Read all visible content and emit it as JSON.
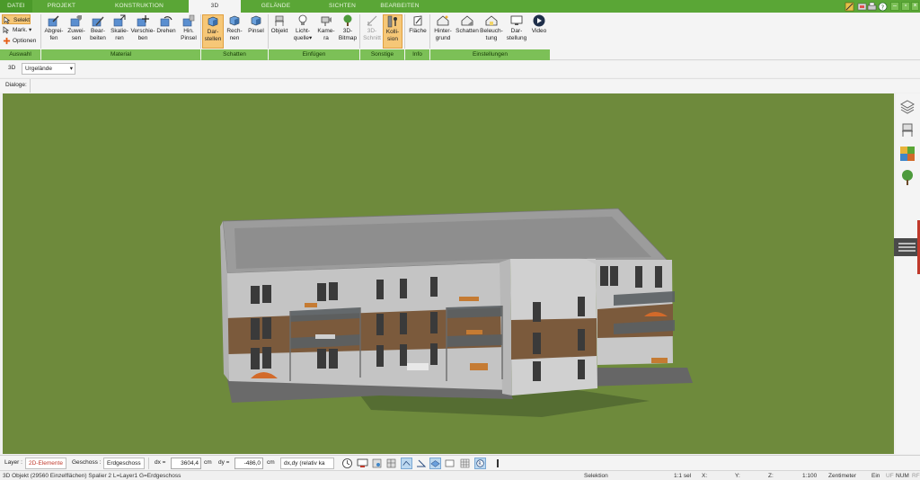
{
  "tabs": [
    {
      "label": "DATEI",
      "active": false
    },
    {
      "label": "PROJEKT",
      "active": false
    },
    {
      "label": "KONSTRUKTION",
      "active": false
    },
    {
      "label": "3D",
      "active": true
    },
    {
      "label": "GELÄNDE",
      "active": false
    },
    {
      "label": "SICHTEN",
      "active": false
    },
    {
      "label": "BEARBEITEN",
      "active": false
    }
  ],
  "ribbon": {
    "selection": [
      {
        "label": "Selekt",
        "icon": "cursor-icon",
        "active": true
      },
      {
        "label": "Mark.",
        "icon": "marker-icon",
        "has_dropdown": true
      },
      {
        "label": "Optionen",
        "icon": "plus-icon"
      }
    ],
    "material_buttons": [
      {
        "label": "Abgrei-\nfen",
        "icon": "eyedropper-icon"
      },
      {
        "label": "Zuwei-\nsen",
        "icon": "assign-material-icon"
      },
      {
        "label": "Bear-\nbeiten",
        "icon": "edit-material-icon"
      },
      {
        "label": "Skalie-\nren",
        "icon": "scale-icon"
      },
      {
        "label": "Verschie-\nben",
        "icon": "move-icon"
      },
      {
        "label": "Drehen",
        "icon": "rotate-icon"
      },
      {
        "label": "Hin.\nPinsel",
        "icon": "brush-icon"
      }
    ],
    "shadow_buttons": [
      {
        "label": "Dar-\nstellen",
        "icon": "cube-shade-icon",
        "active": true
      },
      {
        "label": "Rech-\nnen",
        "icon": "cube-calc-icon"
      },
      {
        "label": "Pinsel",
        "icon": "cube-brush-icon"
      }
    ],
    "insert_buttons": [
      {
        "label": "Objekt",
        "icon": "chair-icon"
      },
      {
        "label": "Licht-\nquelle",
        "icon": "lightbulb-icon",
        "has_dropdown": true
      },
      {
        "label": "Kame-\nra",
        "icon": "camera-icon"
      },
      {
        "label": "3D-\nBitmap",
        "icon": "tree-icon"
      }
    ],
    "other_buttons": [
      {
        "label": "3D-\nSchnitt",
        "icon": "section-icon",
        "disabled": true
      },
      {
        "label": "Kolli-\nsion",
        "icon": "collision-icon",
        "active": true
      }
    ],
    "info_buttons": [
      {
        "label": "Fläche",
        "icon": "area-icon"
      }
    ],
    "settings_buttons": [
      {
        "label": "Hinter-\ngrund",
        "icon": "background-house-icon"
      },
      {
        "label": "Schatten",
        "icon": "shadow-house-icon"
      },
      {
        "label": "Beleuch-\ntung",
        "icon": "lighting-house-icon"
      },
      {
        "label": "Dar-\nstellung",
        "icon": "display-monitor-icon"
      },
      {
        "label": "Video",
        "icon": "play-icon"
      }
    ],
    "groups": [
      "Auswahl",
      "Material",
      "Schatten",
      "Einfügen",
      "Sonstige",
      "Info",
      "Einstellungen"
    ]
  },
  "option_bar": {
    "mode": "3D",
    "terrain_option": "Urgelände"
  },
  "dialog_bar": {
    "label": "Dialoge:"
  },
  "bottom": {
    "layer_label": "Layer :",
    "layer_value": "2D-Elemente",
    "floor_label": "Geschoss :",
    "floor_value": "Erdgeschoss",
    "dx_label": "dx =",
    "dx_value": "3604,4",
    "dy_label": "dy =",
    "dy_value": "-486,0",
    "unit": "cm",
    "mode_value": "dx,dy (relativ ka"
  },
  "status": {
    "info": "3D Objekt (29560 Einzelflächen) Spalier 2 L=Layer1 G=Erdgeschoss",
    "mode": "Selektion",
    "selection_count": "1:1 sel",
    "x_label": "X:",
    "y_label": "Y:",
    "z_label": "Z:",
    "scale": "1:100",
    "unit": "Zentimeter",
    "ein": "Ein",
    "uf": "UF",
    "num": "NUM",
    "rf": "RF"
  },
  "colors": {
    "tab_green": "#5aa636",
    "group_green": "#7cc057",
    "highlight_orange": "#f6c777",
    "terrain": "#6e8a3c"
  }
}
